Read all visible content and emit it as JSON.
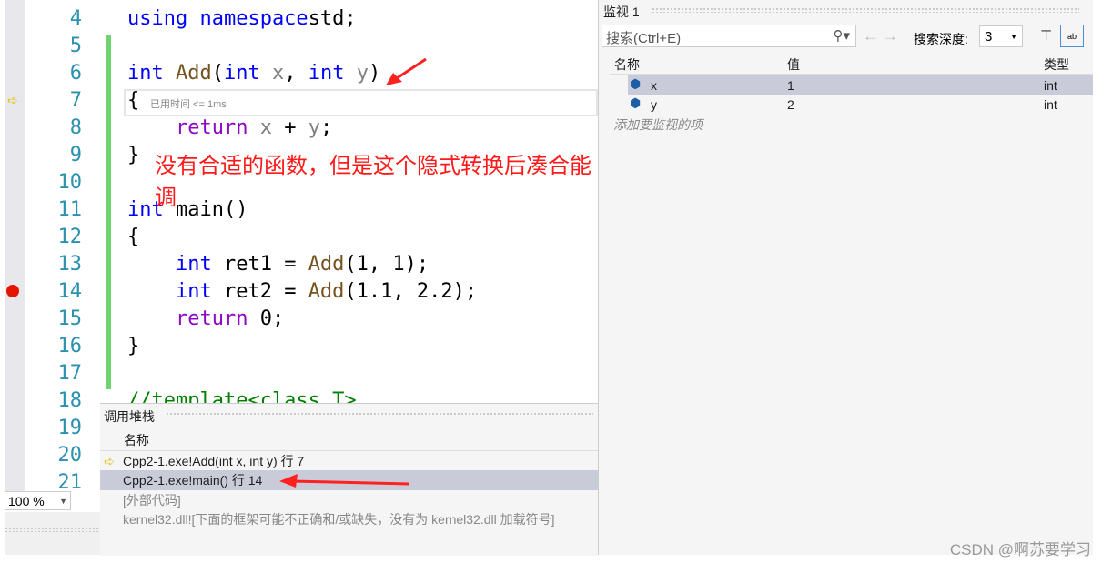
{
  "editor": {
    "lines": [
      {
        "n": "4",
        "parts": [
          [
            "kw",
            "using namespace"
          ],
          [
            "",
            "std;"
          ]
        ]
      },
      {
        "n": "5",
        "parts": []
      },
      {
        "n": "6",
        "parts": [
          [
            "kw",
            "int "
          ],
          [
            "fn",
            "Add"
          ],
          [
            "",
            "("
          ],
          [
            "kw",
            "int "
          ],
          [
            "pm",
            "x"
          ],
          [
            "",
            ", "
          ],
          [
            "kw",
            "int "
          ],
          [
            "pm",
            "y"
          ],
          [
            "",
            ")"
          ]
        ]
      },
      {
        "n": "7",
        "parts": [
          [
            "",
            "{"
          ]
        ]
      },
      {
        "n": "8",
        "parts": [
          [
            "",
            "    "
          ],
          [
            "ret",
            "return "
          ],
          [
            "pm",
            "x"
          ],
          [
            "",
            " + "
          ],
          [
            "pm",
            "y"
          ],
          [
            "",
            ";"
          ]
        ]
      },
      {
        "n": "9",
        "parts": [
          [
            "",
            "}"
          ]
        ]
      },
      {
        "n": "10",
        "parts": []
      },
      {
        "n": "11",
        "parts": [
          [
            "kw",
            "int "
          ],
          [
            "",
            "main()"
          ]
        ]
      },
      {
        "n": "12",
        "parts": [
          [
            "",
            "{"
          ]
        ]
      },
      {
        "n": "13",
        "parts": [
          [
            "",
            "    "
          ],
          [
            "kw",
            "int "
          ],
          [
            "",
            "ret1 = "
          ],
          [
            "fn",
            "Add"
          ],
          [
            "",
            "(1, 1);"
          ]
        ]
      },
      {
        "n": "14",
        "parts": [
          [
            "",
            "    "
          ],
          [
            "kw",
            "int "
          ],
          [
            "",
            "ret2 = "
          ],
          [
            "fn",
            "Add"
          ],
          [
            "",
            "(1.1, 2.2);"
          ]
        ]
      },
      {
        "n": "15",
        "parts": [
          [
            "",
            "    "
          ],
          [
            "ret",
            "return "
          ],
          [
            "",
            "0;"
          ]
        ]
      },
      {
        "n": "16",
        "parts": [
          [
            "",
            "}"
          ]
        ]
      },
      {
        "n": "17",
        "parts": []
      },
      {
        "n": "18",
        "parts": [
          [
            "cm",
            "//template<class T>"
          ]
        ]
      },
      {
        "n": "19",
        "parts": []
      },
      {
        "n": "20",
        "parts": []
      },
      {
        "n": "21",
        "parts": []
      }
    ],
    "elapsed": "已用时间 <= 1ms",
    "annotation": "没有合适的函数，但是这个隐式转换后凑合能调",
    "zoom": "100 %"
  },
  "watch": {
    "title": "监视 1",
    "search_placeholder": "搜索(Ctrl+E)",
    "depth_label": "搜索深度:",
    "depth_value": "3",
    "columns": [
      "名称",
      "值",
      "类型"
    ],
    "rows": [
      {
        "name": "x",
        "value": "1",
        "type": "int"
      },
      {
        "name": "y",
        "value": "2",
        "type": "int"
      }
    ],
    "add_item": "添加要监视的项"
  },
  "callstack": {
    "title": "调用堆栈",
    "column": "名称",
    "rows": [
      "Cpp2-1.exe!Add(int x, int y) 行 7",
      "Cpp2-1.exe!main() 行 14",
      "[外部代码]",
      "kernel32.dll![下面的框架可能不正确和/或缺失，没有为 kernel32.dll 加载符号]"
    ]
  },
  "watermark": "CSDN @啊苏要学习",
  "colors": {
    "annotation": "#ff1a1a",
    "selection": "#c9ccd8",
    "breakpoint": "#e51400"
  }
}
